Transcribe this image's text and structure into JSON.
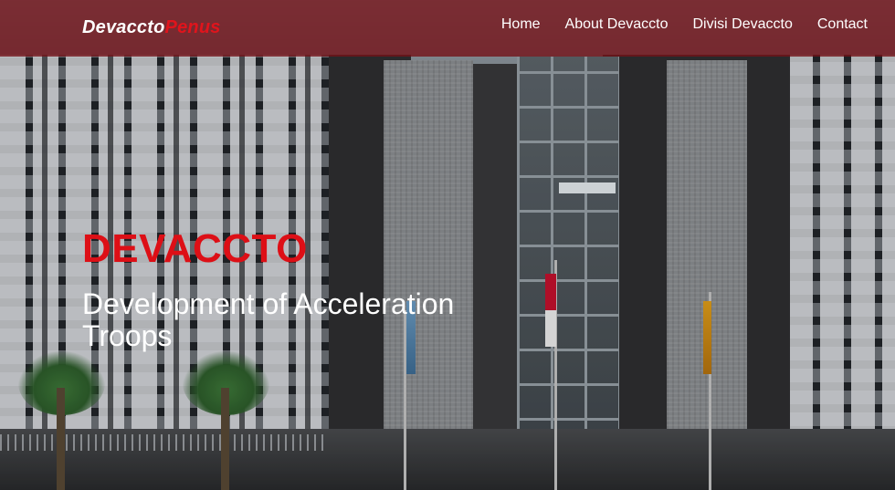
{
  "brand": {
    "part1": "Devaccto",
    "part2": "Penus"
  },
  "nav": {
    "items": [
      {
        "label": "Home"
      },
      {
        "label": "About Devaccto"
      },
      {
        "label": "Divisi Devaccto"
      },
      {
        "label": "Contact"
      }
    ]
  },
  "hero": {
    "title": "DEVACCTO",
    "subtitle": "Development of Acceleration Troops"
  },
  "colors": {
    "navbar": "#731218",
    "brand_accent": "#e0141c",
    "hero_title": "#dd0f16",
    "text_light": "#ffffff"
  }
}
